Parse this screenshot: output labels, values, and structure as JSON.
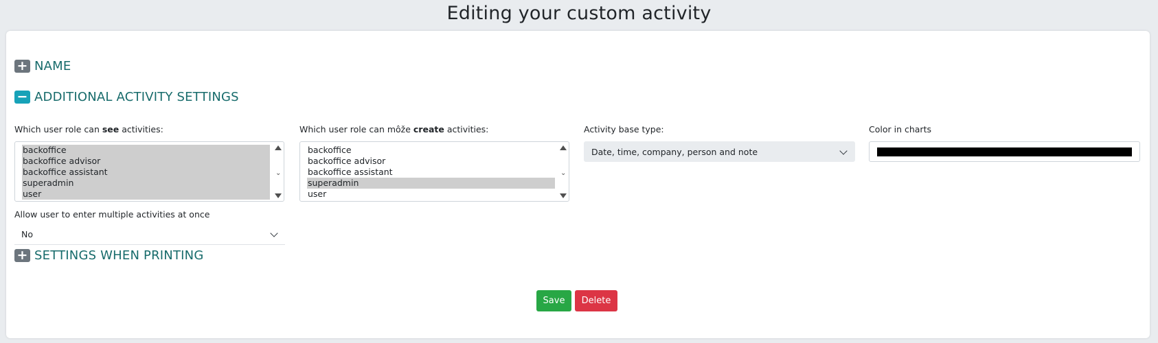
{
  "page": {
    "title": "Editing your custom activity"
  },
  "sections": {
    "name": {
      "label": "NAME",
      "toggle": "+"
    },
    "additional": {
      "label": "ADDITIONAL ACTIVITY SETTINGS",
      "toggle": "−"
    },
    "printing": {
      "label": "SETTINGS WHEN PRINTING",
      "toggle": "+"
    }
  },
  "see_roles": {
    "label_prefix": "Which user role can ",
    "label_bold": "see",
    "label_suffix": " activities:",
    "options": [
      {
        "text": "backoffice",
        "selected": true
      },
      {
        "text": "backoffice advisor",
        "selected": true
      },
      {
        "text": "backoffice assistant",
        "selected": true
      },
      {
        "text": "superadmin",
        "selected": true
      },
      {
        "text": "user",
        "selected": true
      }
    ]
  },
  "create_roles": {
    "label_prefix": "Which user role can môže ",
    "label_bold": "create",
    "label_suffix": " activities:",
    "options": [
      {
        "text": "backoffice",
        "selected": false
      },
      {
        "text": "backoffice advisor",
        "selected": false
      },
      {
        "text": "backoffice assistant",
        "selected": false
      },
      {
        "text": "superadmin",
        "selected": true
      },
      {
        "text": "user",
        "selected": false
      }
    ]
  },
  "base_type": {
    "label": "Activity base type:",
    "value": "Date, time, company, person and note"
  },
  "chart_color": {
    "label": "Color in charts",
    "value": "#000000"
  },
  "multiple": {
    "label": "Allow user to enter multiple activities at once",
    "value": "No"
  },
  "buttons": {
    "save": "Save",
    "delete": "Delete"
  },
  "colors": {
    "section_title": "#176b6b",
    "save": "#28a745",
    "delete": "#dc3545",
    "select_bg": "#e9ecef"
  }
}
